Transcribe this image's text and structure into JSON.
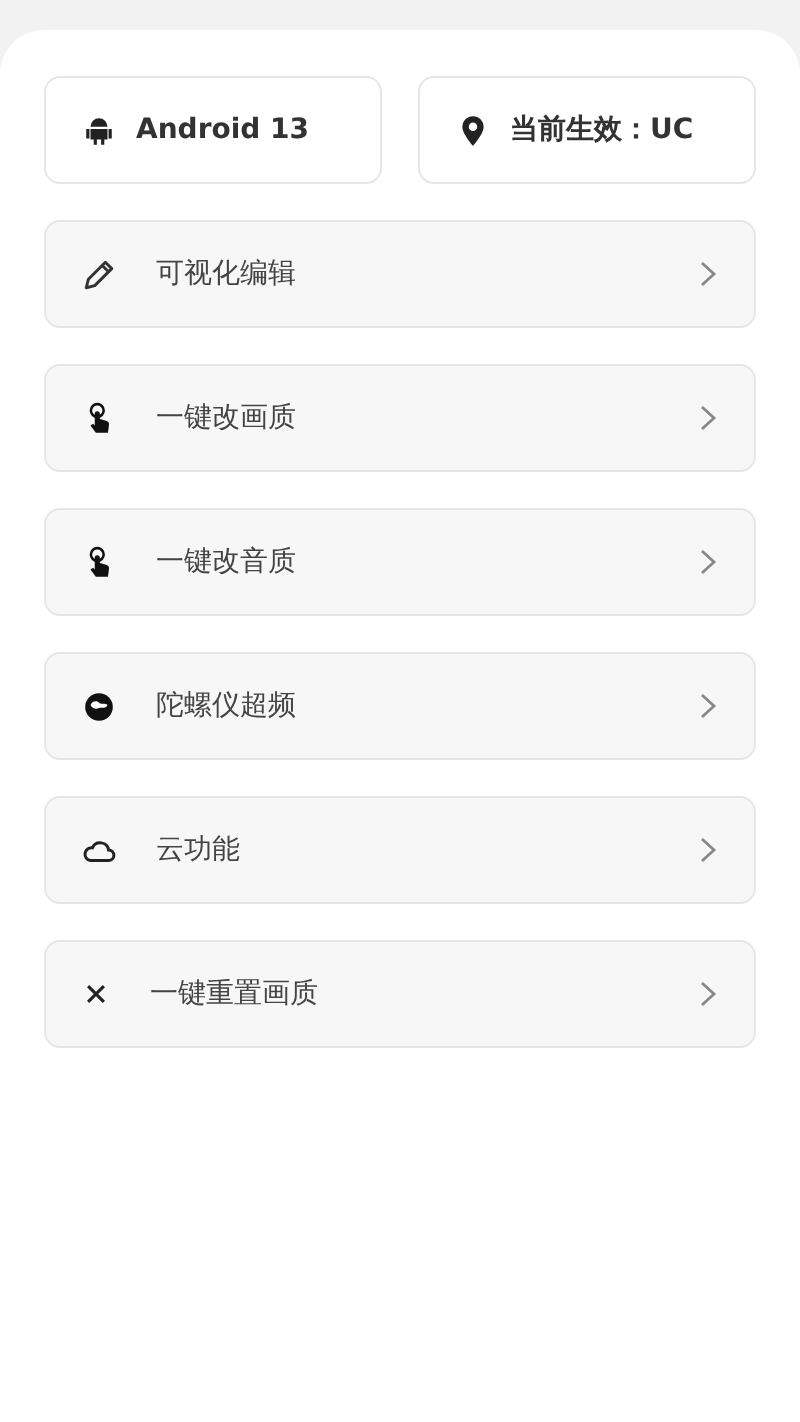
{
  "info_cards": [
    {
      "kind": "android",
      "label": "Android 13"
    },
    {
      "kind": "pin",
      "label": "当前生效：UC"
    }
  ],
  "menu": [
    {
      "kind": "pencil",
      "label": "可视化编辑"
    },
    {
      "kind": "hand",
      "label": "一键改画质"
    },
    {
      "kind": "hand",
      "label": "一键改音质"
    },
    {
      "kind": "gyro",
      "label": "陀螺仪超频"
    },
    {
      "kind": "cloud",
      "label": "云功能"
    },
    {
      "kind": "close",
      "label": "一键重置画质"
    }
  ]
}
